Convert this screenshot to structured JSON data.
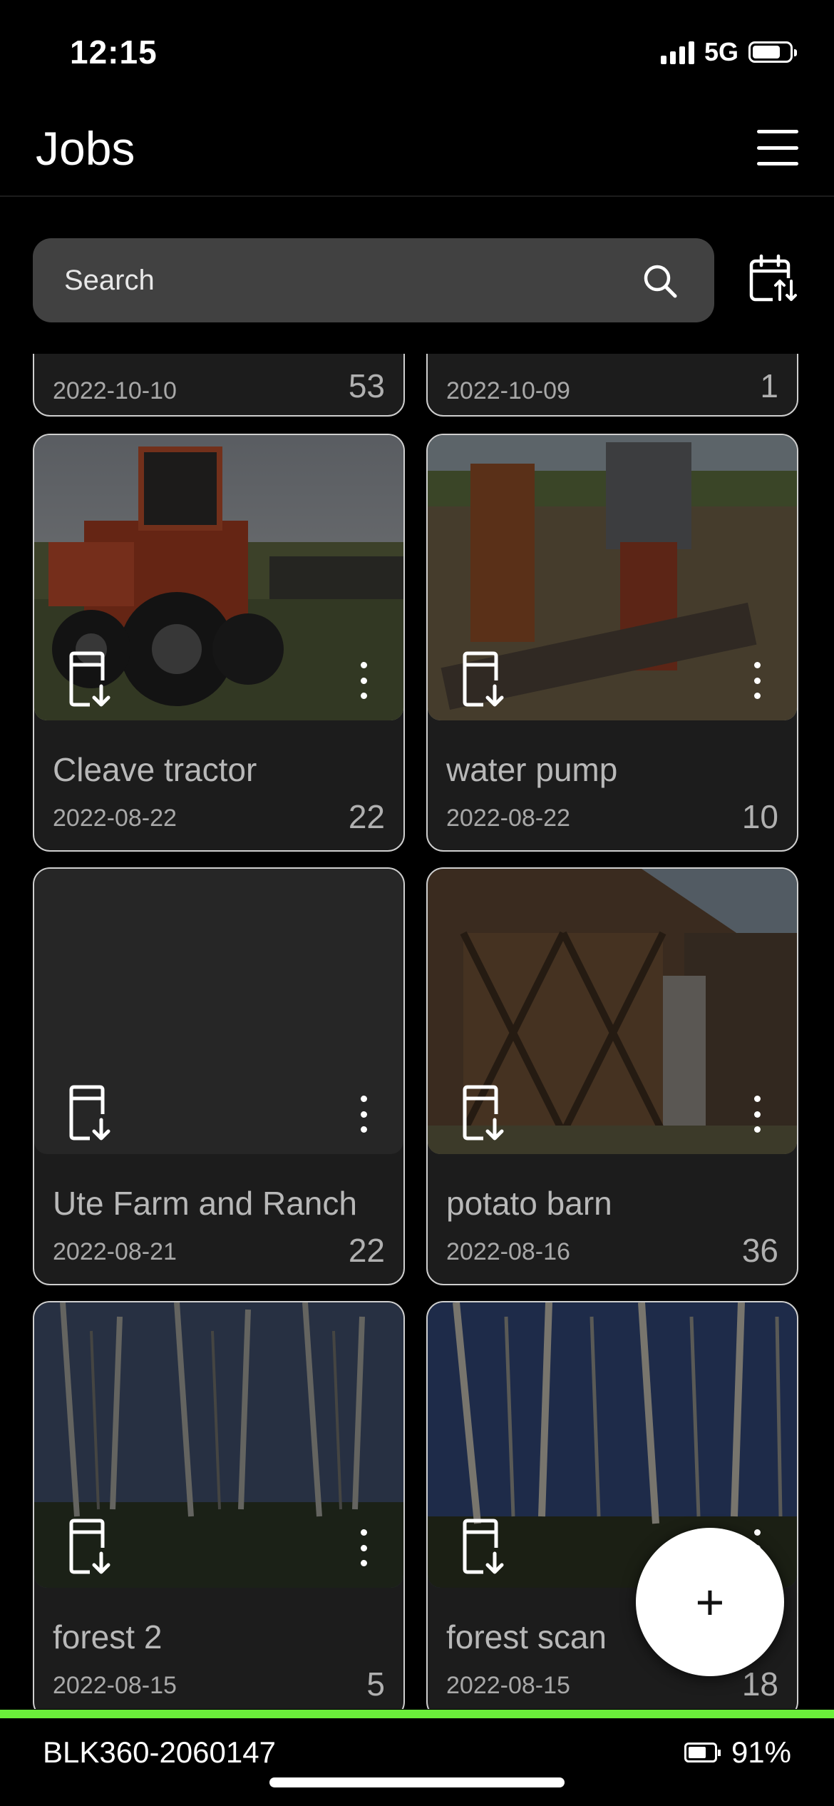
{
  "status_bar": {
    "time": "12:15",
    "network": "5G"
  },
  "header": {
    "title": "Jobs"
  },
  "search": {
    "placeholder": "Search"
  },
  "partial_cards": [
    {
      "date": "2022-10-10",
      "count": "53"
    },
    {
      "date": "2022-10-09",
      "count": "1"
    }
  ],
  "cards": [
    {
      "title": "Cleave tractor",
      "date": "2022-08-22",
      "count": "22",
      "thumbnail": "tractor-photo"
    },
    {
      "title": "water pump",
      "date": "2022-08-22",
      "count": "10",
      "thumbnail": "water-pump-photo"
    },
    {
      "title": "Ute Farm and Ranch",
      "date": "2022-08-21",
      "count": "22",
      "thumbnail": "none"
    },
    {
      "title": "potato barn",
      "date": "2022-08-16",
      "count": "36",
      "thumbnail": "barn-photo"
    },
    {
      "title": "forest 2",
      "date": "2022-08-15",
      "count": "5",
      "thumbnail": "forest-photo"
    },
    {
      "title": "forest scan",
      "date": "2022-08-15",
      "count": "18",
      "thumbnail": "forest-photo"
    }
  ],
  "fab": {
    "label": "+"
  },
  "device": {
    "name": "BLK360-2060147",
    "battery": "91%"
  },
  "colors": {
    "accent": "#6bf03a",
    "background": "#000000",
    "card": "#1c1c1c",
    "search": "#414141"
  },
  "icons": [
    "signal-icon",
    "battery-icon",
    "menu-icon",
    "search-icon",
    "calendar-sort-icon",
    "download-icon",
    "more-vertical-icon",
    "plus-icon"
  ]
}
